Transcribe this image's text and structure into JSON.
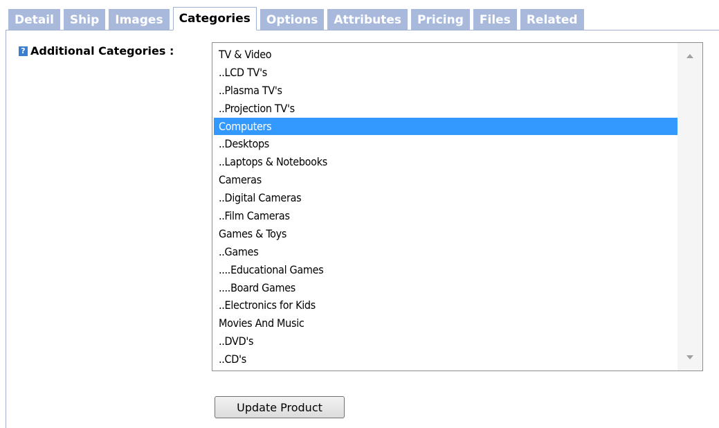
{
  "tabs": [
    {
      "label": "Detail",
      "active": false
    },
    {
      "label": "Ship",
      "active": false
    },
    {
      "label": "Images",
      "active": false
    },
    {
      "label": "Categories",
      "active": true
    },
    {
      "label": "Options",
      "active": false
    },
    {
      "label": "Attributes",
      "active": false
    },
    {
      "label": "Pricing",
      "active": false
    },
    {
      "label": "Files",
      "active": false
    },
    {
      "label": "Related",
      "active": false
    }
  ],
  "field": {
    "help_icon": "?",
    "label": "Additional Categories :"
  },
  "categories": [
    {
      "label": "TV & Video",
      "selected": false
    },
    {
      "label": "..LCD TV's",
      "selected": false
    },
    {
      "label": "..Plasma TV's",
      "selected": false
    },
    {
      "label": "..Projection TV's",
      "selected": false
    },
    {
      "label": "Computers",
      "selected": true
    },
    {
      "label": "..Desktops",
      "selected": false
    },
    {
      "label": "..Laptops & Notebooks",
      "selected": false
    },
    {
      "label": "Cameras",
      "selected": false
    },
    {
      "label": "..Digital Cameras",
      "selected": false
    },
    {
      "label": "..Film Cameras",
      "selected": false
    },
    {
      "label": "Games & Toys",
      "selected": false
    },
    {
      "label": "..Games",
      "selected": false
    },
    {
      "label": "....Educational Games",
      "selected": false
    },
    {
      "label": "....Board Games",
      "selected": false
    },
    {
      "label": "..Electronics for Kids",
      "selected": false
    },
    {
      "label": "Movies And Music",
      "selected": false
    },
    {
      "label": "..DVD's",
      "selected": false
    },
    {
      "label": "..CD's",
      "selected": false
    }
  ],
  "actions": {
    "update_label": "Update Product"
  },
  "colors": {
    "tab_inactive": "#a8b9db",
    "selection": "#3399ff",
    "help_icon": "#3b7fd3"
  }
}
